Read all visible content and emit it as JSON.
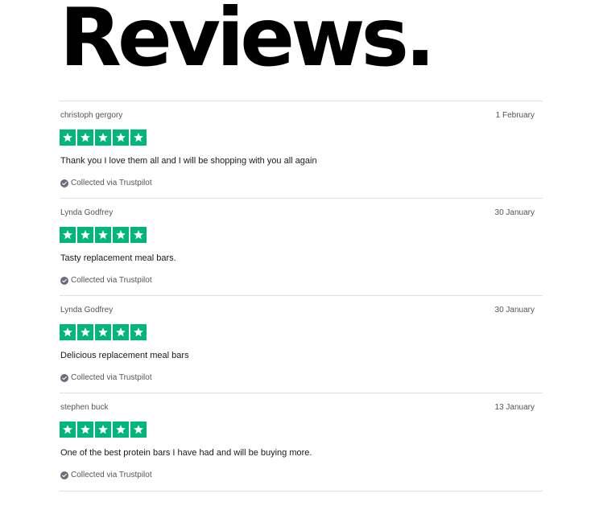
{
  "page": {
    "title": "Reviews."
  },
  "colors": {
    "star_green": "#00b67a",
    "divider": "#e1e1e1",
    "muted_text": "#555555"
  },
  "reviews": [
    {
      "reviewer": "christoph gergory",
      "date": "1 February",
      "rating": 5,
      "text": "Thank you I love them all and I will be shopping with you all again",
      "source": "Collected via Trustpilot",
      "source_icon": "check-circle-icon"
    },
    {
      "reviewer": "Lynda Godfrey",
      "date": "30 January",
      "rating": 5,
      "text": "Tasty replacement meal bars.",
      "source": "Collected via Trustpilot",
      "source_icon": "check-circle-icon"
    },
    {
      "reviewer": "Lynda Godfrey",
      "date": "30 January",
      "rating": 5,
      "text": "Delicious replacement meal bars",
      "source": "Collected via Trustpilot",
      "source_icon": "check-circle-icon"
    },
    {
      "reviewer": "stephen buck",
      "date": "13 January",
      "rating": 5,
      "text": "One of the best protein bars I have had and will be buying more.",
      "source": "Collected via Trustpilot",
      "source_icon": "check-circle-icon"
    }
  ]
}
